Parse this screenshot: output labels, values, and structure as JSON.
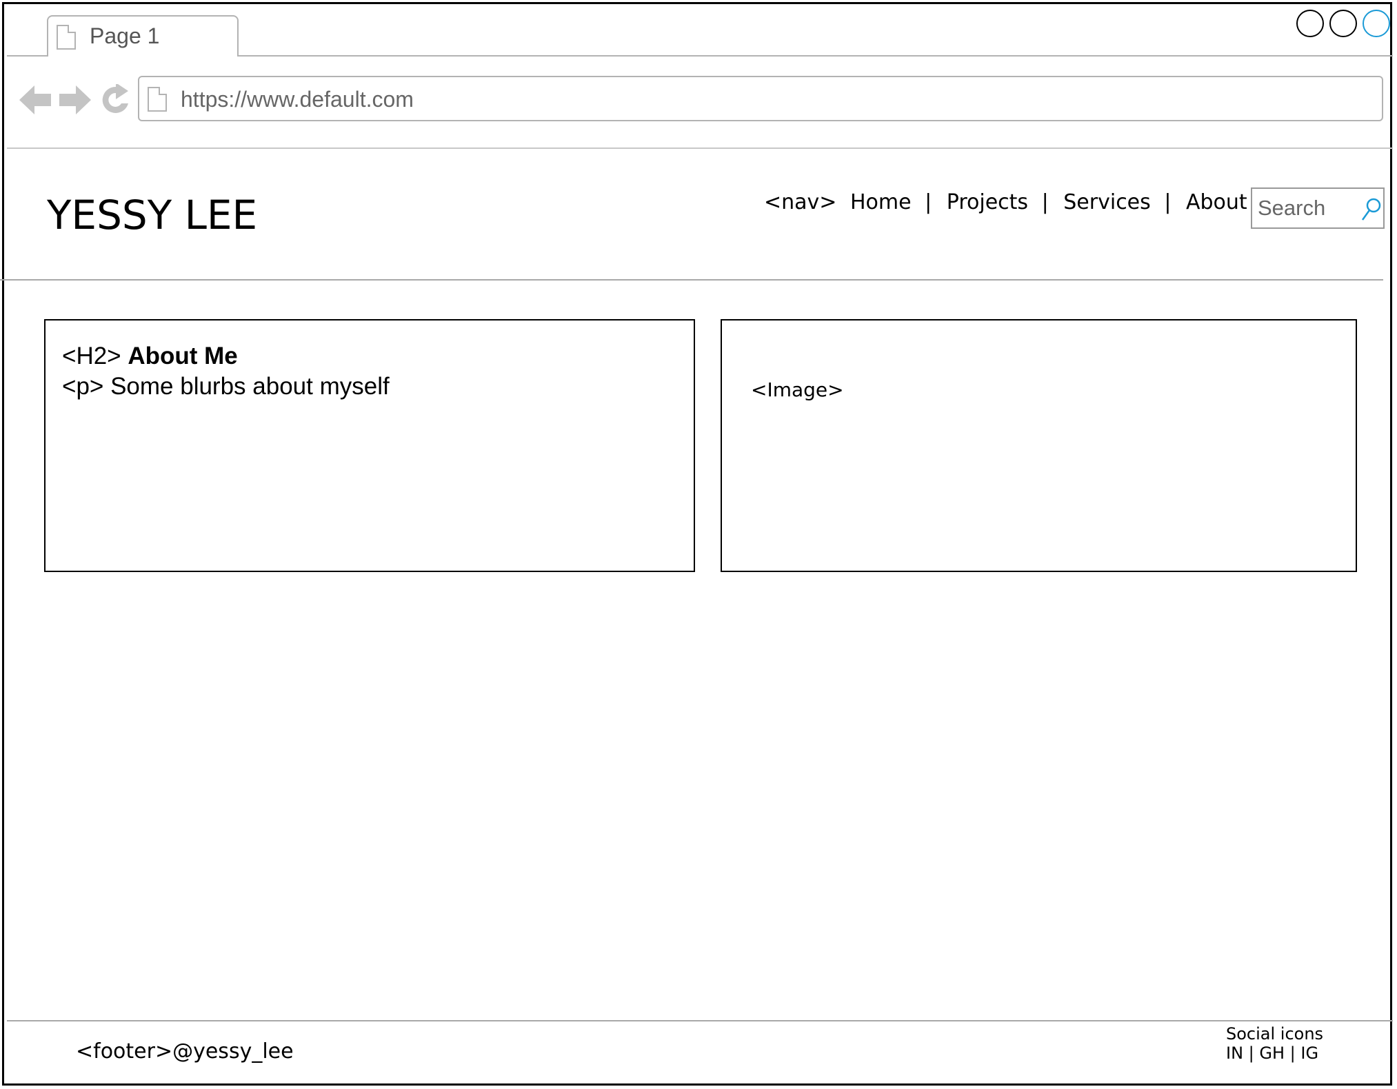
{
  "browser": {
    "tab_label": "Page 1",
    "url": "https://www.default.com",
    "accent": "#1a9ad6"
  },
  "site": {
    "brand": "YESSY LEE",
    "nav_prefix": "<nav>",
    "nav_items": [
      "Home",
      "Projects",
      "Services",
      "About Me"
    ],
    "nav_separator": "|",
    "search_placeholder": "Search"
  },
  "main": {
    "about_tag": "<H2>",
    "about_heading": "About Me",
    "about_text": "<p> Some blurbs about myself",
    "image_label": "<Image>"
  },
  "footer": {
    "handle": "<footer>@yessy_lee",
    "social_title": "Social icons",
    "social_links": "IN | GH | IG"
  }
}
